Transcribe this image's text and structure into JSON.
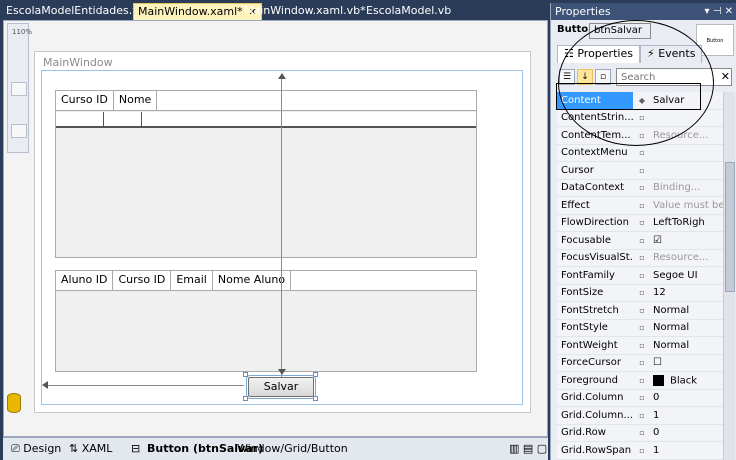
{
  "tabs": [
    {
      "label": "EscolaModelEntidades.vb",
      "active": false
    },
    {
      "label": "MainWindow.xaml*",
      "active": true
    },
    {
      "label": "MainWindow.xaml.vb*",
      "active": false
    },
    {
      "label": "EscolaModel.vb",
      "active": false
    }
  ],
  "designer": {
    "zoom_label": "110%",
    "window_title": "MainWindow",
    "grid1_columns": [
      "Curso ID",
      "Nome"
    ],
    "grid2_columns": [
      "Aluno ID",
      "Curso ID",
      "Email",
      "Nome Aluno"
    ],
    "button_label": "Salvar"
  },
  "bottombar": {
    "design_tab": "Design",
    "xaml_tab": "XAML",
    "selected": "Button (btnSalvar)",
    "path": "Window/Grid/Button"
  },
  "props": {
    "title": "Properties",
    "type": "Button",
    "name": "btnSalvar",
    "preview": "Button",
    "tab_properties": "Properties",
    "tab_events": "Events",
    "search_placeholder": "Search",
    "rows": [
      {
        "name": "Content",
        "value": "Salvar",
        "selected": true
      },
      {
        "name": "ContentStrin...",
        "value": ""
      },
      {
        "name": "ContentTem...",
        "value": "Resource...",
        "muted": true
      },
      {
        "name": "ContextMenu",
        "value": ""
      },
      {
        "name": "Cursor",
        "value": ""
      },
      {
        "name": "DataContext",
        "value": "Binding...",
        "muted": true
      },
      {
        "name": "Effect",
        "value": "Value must be",
        "muted": true
      },
      {
        "name": "FlowDirection",
        "value": "LeftToRigh"
      },
      {
        "name": "Focusable",
        "value": "☑"
      },
      {
        "name": "FocusVisualSt...",
        "value": "Resource...",
        "muted": true
      },
      {
        "name": "FontFamily",
        "value": "Segoe UI"
      },
      {
        "name": "FontSize",
        "value": "12"
      },
      {
        "name": "FontStretch",
        "value": "Normal"
      },
      {
        "name": "FontStyle",
        "value": "Normal"
      },
      {
        "name": "FontWeight",
        "value": "Normal"
      },
      {
        "name": "ForceCursor",
        "value": "☐"
      },
      {
        "name": "Foreground",
        "value": "Black"
      },
      {
        "name": "Grid.Column",
        "value": "0"
      },
      {
        "name": "Grid.Column...",
        "value": "1"
      },
      {
        "name": "Grid.Row",
        "value": "0"
      },
      {
        "name": "Grid.RowSpan",
        "value": "1"
      }
    ]
  },
  "colors": {
    "title_bar": "#3d5277",
    "selected_row": "#3399ff",
    "active_tab": "#fdf3bd"
  }
}
